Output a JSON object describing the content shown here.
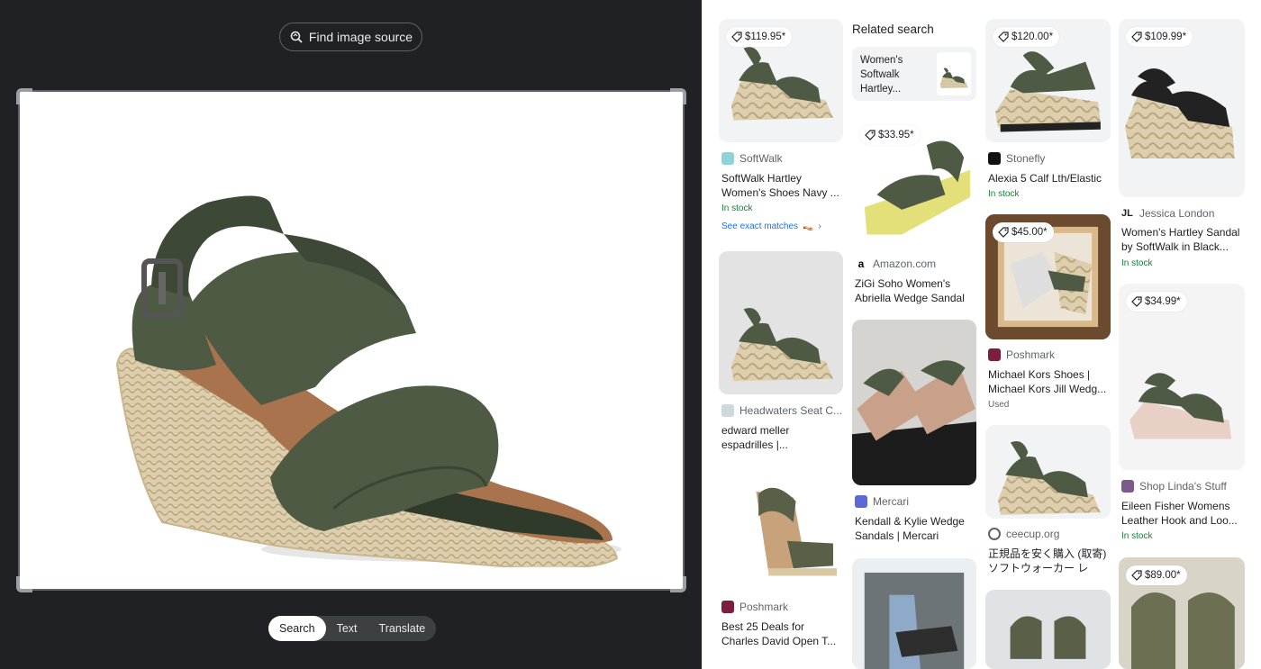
{
  "left_panel": {
    "find_source_label": "Find image source",
    "modes": [
      {
        "label": "Search",
        "active": true
      },
      {
        "label": "Text",
        "active": false
      },
      {
        "label": "Translate",
        "active": false
      }
    ]
  },
  "related_search": {
    "title": "Related search",
    "query": "Women's Softwalk Hartley..."
  },
  "results": {
    "r1": {
      "price": "$119.95*",
      "source": "SoftWalk",
      "title": "SoftWalk Hartley Women's Shoes Navy ...",
      "stock": "In stock",
      "exact_matches": "See exact matches"
    },
    "r2": {
      "source": "Headwaters Seat C...",
      "title": "edward meller espadrilles |..."
    },
    "r3": {
      "source": "Poshmark",
      "title": "Best 25 Deals for Charles David Open T..."
    },
    "r4": {
      "price": "$33.95*",
      "source": "Amazon.com",
      "title": "ZiGi Soho Women's Abriella Wedge Sandal"
    },
    "r5": {
      "source": "Mercari",
      "title": "Kendall & Kylie Wedge Sandals | Mercari"
    },
    "r6": {
      "price": "$120.00*",
      "source": "Stonefly",
      "title": "Alexia 5 Calf Lth/Elastic",
      "stock": "In stock"
    },
    "r7": {
      "price": "$45.00*",
      "source": "Poshmark",
      "title": "Michael Kors Shoes | Michael Kors Jill Wedg...",
      "condition": "Used"
    },
    "r8": {
      "source": "ceecup.org",
      "title": "正規品を安く購入 (取寄) ソフトウォーカー レデ..."
    },
    "r9": {
      "price": "$109.99*",
      "source": "Jessica London",
      "title": "Women's Hartley Sandal by SoftWalk in Black...",
      "stock": "In stock"
    },
    "r10": {
      "price": "$34.99*",
      "source": "Shop Linda's Stuff",
      "title": "Eileen Fisher Womens Leather Hook and Loo...",
      "stock": "In stock"
    },
    "r11": {
      "price": "$89.00*"
    }
  },
  "colors": {
    "olive": "#4e5a44",
    "jute": "#d9c8a4",
    "tan": "#a9744d",
    "accent": "#1a73e8",
    "stock": "#188038"
  }
}
